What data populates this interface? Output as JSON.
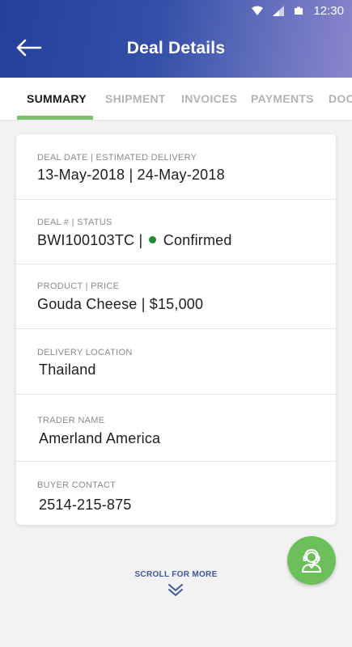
{
  "status_bar": {
    "time": "12:30"
  },
  "header": {
    "title": "Deal Details"
  },
  "tabs": [
    {
      "label": "SUMMARY",
      "active": true
    },
    {
      "label": "SHIPMENT",
      "active": false
    },
    {
      "label": "INVOICES",
      "active": false
    },
    {
      "label": "PAYMENTS",
      "active": false
    },
    {
      "label": "DOC",
      "active": false
    }
  ],
  "summary": {
    "deal_dates": {
      "label": "DEAL DATE  |  ESTIMATED DELIVERY",
      "value": "13-May-2018  |  24-May-2018"
    },
    "deal_status": {
      "label": "DEAL #  |  STATUS",
      "deal_number": "BWI100103TC  |",
      "status": "Confirmed",
      "status_color": "#1e8e2e"
    },
    "product_price": {
      "label": "PRODUCT  |  PRICE",
      "value": "Gouda Cheese  |  $15,000"
    },
    "delivery_location": {
      "label": "DELIVERY LOCATION",
      "value": "Thailand"
    },
    "trader_name": {
      "label": "TRADER NAME",
      "value": "Amerland America"
    },
    "buyer_contact": {
      "label": "BUYER CONTACT",
      "value": "2514-215-875"
    }
  },
  "scroll_hint": "SCROLL FOR MORE",
  "colors": {
    "header_start": "#23409a",
    "header_end": "#8a86cc",
    "accent_green": "#7cc16a",
    "fab_green": "#6cbf5a"
  },
  "icons": [
    "wifi-icon",
    "signal-icon",
    "battery-icon",
    "back-arrow-icon",
    "double-chevron-down-icon",
    "support-agent-icon"
  ]
}
